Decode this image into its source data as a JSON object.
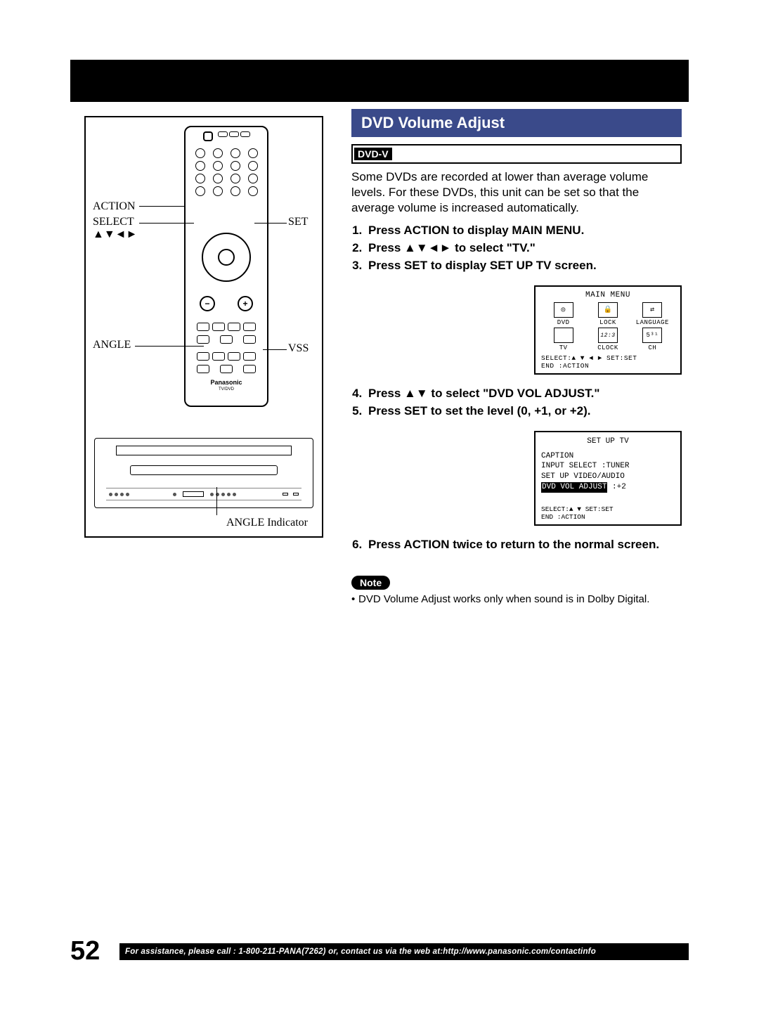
{
  "page_number": "52",
  "footer_text": "For assistance, please call : 1-800-211-PANA(7262) or, contact us via the web at:http://www.panasonic.com/contactinfo",
  "callouts": {
    "action": "ACTION",
    "select": "SELECT\n▲▼◄►",
    "angle": "ANGLE",
    "set": "SET",
    "vss": "VSS",
    "angle_indicator": "ANGLE Indicator"
  },
  "remote": {
    "brand": "Panasonic",
    "model": "TV/DVD"
  },
  "section_title": "DVD Volume Adjust",
  "dvdv_label": "DVD-V",
  "intro": "Some DVDs are recorded at lower than average volume levels. For these DVDs, this unit can be set so that the average volume is increased automatically.",
  "steps": {
    "s1": "Press ACTION to display MAIN MENU.",
    "s2": "Press ▲▼◄► to select \"TV.\"",
    "s3": "Press SET to display SET UP TV screen.",
    "s4": "Press ▲▼ to select \"DVD VOL ADJUST.\"",
    "s5": "Press SET to set the level (0, +1, or +2).",
    "s6": "Press ACTION twice to return to the normal screen."
  },
  "main_menu": {
    "title": "MAIN MENU",
    "items": [
      {
        "label": "DVD"
      },
      {
        "label": "LOCK"
      },
      {
        "label": "LANGUAGE"
      },
      {
        "label": "TV"
      },
      {
        "label": "CLOCK"
      },
      {
        "label": "CH"
      }
    ],
    "foot1": "SELECT:▲ ▼ ◄ ►   SET:SET",
    "foot2": "END   :ACTION"
  },
  "setup_menu": {
    "title": "SET UP TV",
    "line1": "CAPTION",
    "line2": "INPUT SELECT   :TUNER",
    "line3": "SET UP VIDEO/AUDIO",
    "hl_label": "DVD VOL ADJUST",
    "hl_value": ":+2",
    "foot1": "SELECT:▲ ▼        SET:SET",
    "foot2": "END   :ACTION"
  },
  "note_label": "Note",
  "note_text": "DVD Volume Adjust works only when sound is in Dolby Digital."
}
